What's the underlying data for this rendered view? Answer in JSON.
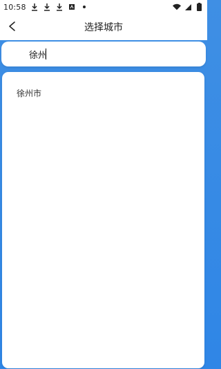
{
  "status_bar": {
    "time": "10:58",
    "icons": [
      "download-icon",
      "download-icon",
      "download-icon",
      "keyboard-icon",
      "dot-icon",
      "wifi-icon",
      "signal-icon",
      "battery-icon"
    ]
  },
  "header": {
    "title": "选择城市",
    "back_icon": "chevron-left-icon"
  },
  "search": {
    "value": "徐州",
    "placeholder": ""
  },
  "results": [
    {
      "label": "徐州市"
    }
  ],
  "colors": {
    "background": "#2f86e6",
    "panel": "#ffffff",
    "text": "#222222"
  }
}
